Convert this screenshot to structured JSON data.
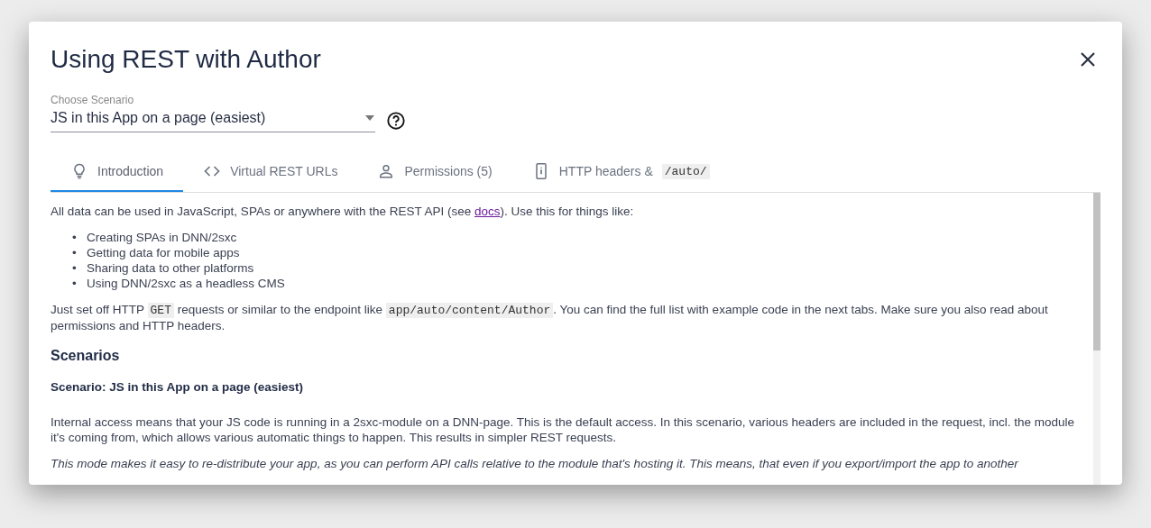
{
  "dialog": {
    "title": "Using REST with Author"
  },
  "scenario": {
    "label": "Choose Scenario",
    "value": "JS in this App on a page (easiest)"
  },
  "tabs": [
    {
      "kind": "bulb",
      "label": "Introduction",
      "selected": true
    },
    {
      "kind": "code",
      "label": "Virtual REST URLs",
      "selected": false
    },
    {
      "kind": "person",
      "label": "Permissions (5)",
      "selected": false
    },
    {
      "kind": "phone",
      "label": "HTTP headers &",
      "code": "/auto/",
      "selected": false
    }
  ],
  "content": {
    "intro": {
      "before": "All data can be used in JavaScript, SPAs or anywhere with the REST API (see ",
      "link": "docs",
      "after": "). Use this for things like:"
    },
    "uses": [
      {
        "marker": "•",
        "text": "Creating SPAs in DNN/2sxc"
      },
      {
        "marker": "•",
        "text": "Getting data for mobile apps"
      },
      {
        "marker": "•",
        "text": "Sharing data to other platforms"
      },
      {
        "marker": "•",
        "text": "Using DNN/2sxc as a headless CMS"
      }
    ],
    "endpoint": [
      {
        "kind": "text",
        "text": "Just set off HTTP "
      },
      {
        "kind": "code",
        "text": "GET"
      },
      {
        "kind": "text",
        "text": " requests or similar to the endpoint like "
      },
      {
        "kind": "code",
        "text": "app/auto/content/Author"
      },
      {
        "kind": "text",
        "text": ". You can find the full list with example code in the next tabs. Make sure you also read about permissions and HTTP headers."
      }
    ],
    "scenarios_heading": "Scenarios",
    "scenario_heading": "Scenario: JS in this App on a page (easiest)",
    "description": "Internal access means that your JS code is running in a 2sxc-module on a DNN-page. This is the default access. In this scenario, various headers are included in the request, incl. the module it's coming from, which allows various automatic things to happen. This results in simpler REST requests.",
    "note": "This mode makes it easy to re-distribute your app, as you can perform API calls relative to the module that's hosting it. This means, that even if you export/import the app to another"
  }
}
